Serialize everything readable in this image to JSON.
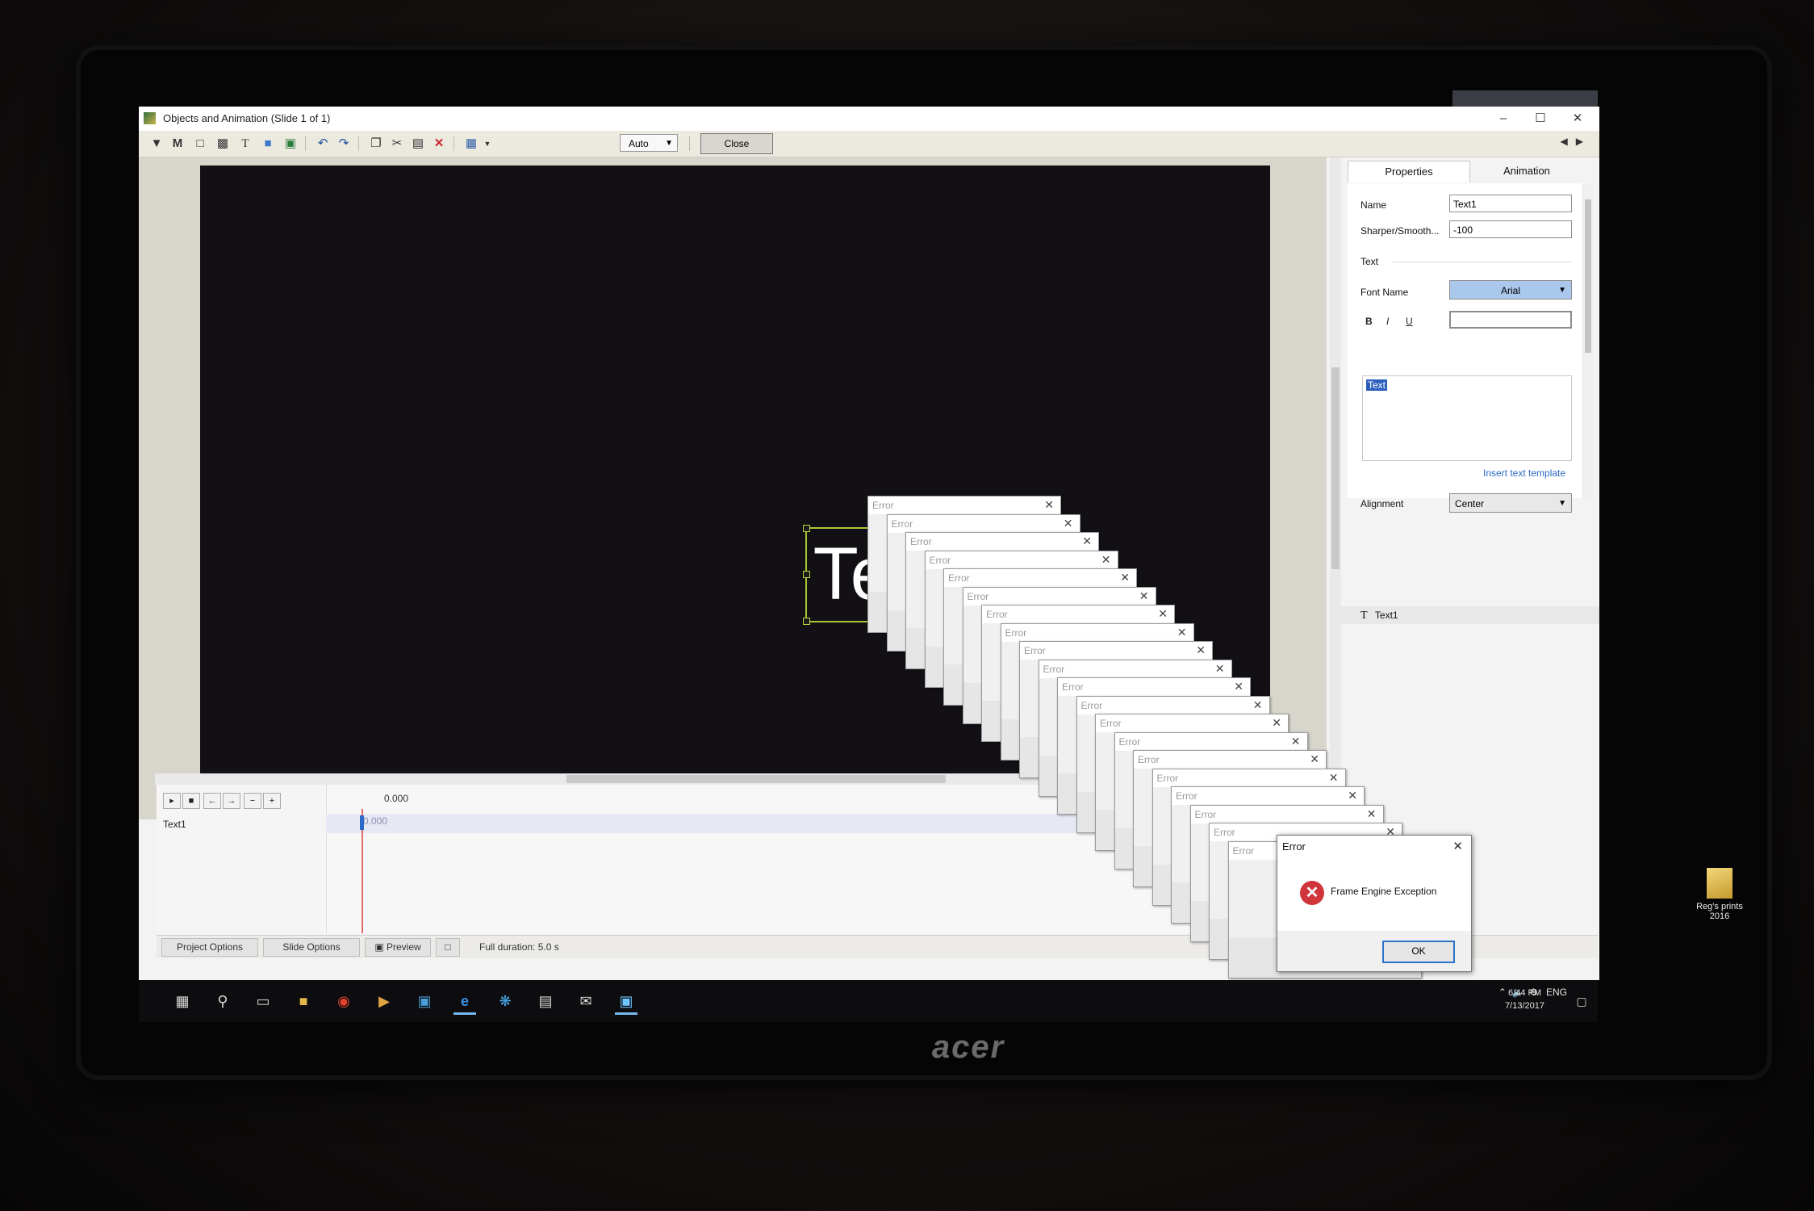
{
  "window": {
    "title": "Objects and Animation (Slide 1 of 1)"
  },
  "toolbar": {
    "zoom_value": "Auto",
    "close_label": "Close",
    "icons": [
      "add-object-icon",
      "mask-icon",
      "frame-icon",
      "button-icon",
      "text-icon",
      "rectangle-icon",
      "image-icon",
      "undo-icon",
      "redo-icon",
      "copy-icon",
      "cut-icon",
      "paste-icon",
      "delete-icon",
      "grid-icon"
    ]
  },
  "stage": {
    "text_object_value": "Text"
  },
  "timeline": {
    "time_label": "0.000",
    "track_time": "0.000",
    "object_label": "Text1",
    "controls": [
      "▸",
      "■",
      "←",
      "→",
      "−",
      "+"
    ]
  },
  "statusbar": {
    "project_options": "Project Options",
    "slide_options": "Slide Options",
    "preview": "Preview",
    "full_duration": "Full duration: 5.0 s"
  },
  "panel": {
    "tab_properties": "Properties",
    "tab_animation": "Animation",
    "name_label": "Name",
    "name_value": "Text1",
    "sharper_label": "Sharper/Smooth...",
    "sharper_value": "-100",
    "text_section": "Text",
    "font_label": "Font Name",
    "font_value": "Arial",
    "bold": "B",
    "italic": "I",
    "underline": "U",
    "text_content": "Text",
    "insert_template": "Insert text template",
    "alignment_label": "Alignment",
    "alignment_value": "Center",
    "object_item": "Text1"
  },
  "error_cascade": {
    "title": "Error",
    "count": 20
  },
  "error_dialog": {
    "title": "Error",
    "message": "Frame Engine Exception",
    "ok_label": "OK"
  },
  "desktop": {
    "icon_label_line1": "Reg's prints",
    "icon_label_line2": "2016"
  },
  "taskbar": {
    "lang": "ENG",
    "time": "6:44 PM",
    "date": "7/13/2017"
  },
  "monitor": {
    "brand": "acer"
  }
}
